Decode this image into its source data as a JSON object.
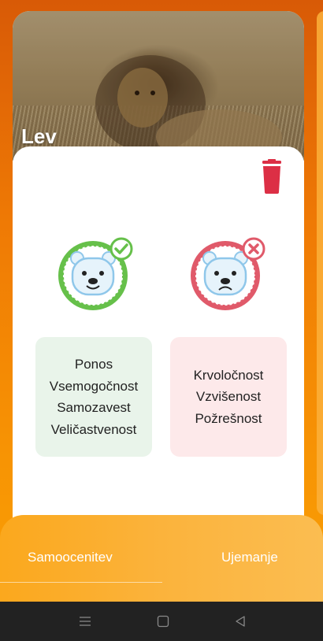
{
  "card": {
    "title": "Lev",
    "image_subject": "lion"
  },
  "positive": {
    "icon": "happy-bear-check-icon",
    "color": "#66c04a",
    "traits": [
      "Ponos",
      "Vsemogočnost",
      "Samozavest",
      "Veličastvenost"
    ]
  },
  "negative": {
    "icon": "sad-bear-cross-icon",
    "color": "#e05a6a",
    "traits": [
      "Krvoločnost",
      "Vzvišenost",
      "Požrešnost"
    ]
  },
  "actions": {
    "delete_icon": "trash-icon",
    "delete_color": "#dc2f45"
  },
  "bottom_nav": {
    "left_label": "Samoocenitev",
    "right_label": "Ujemanje"
  },
  "system_nav": {
    "icons": [
      "menu-icon",
      "home-icon",
      "back-icon"
    ]
  },
  "colors": {
    "accent": "#f79304",
    "positive_bg": "#e9f4ea",
    "negative_bg": "#fde9ea"
  }
}
